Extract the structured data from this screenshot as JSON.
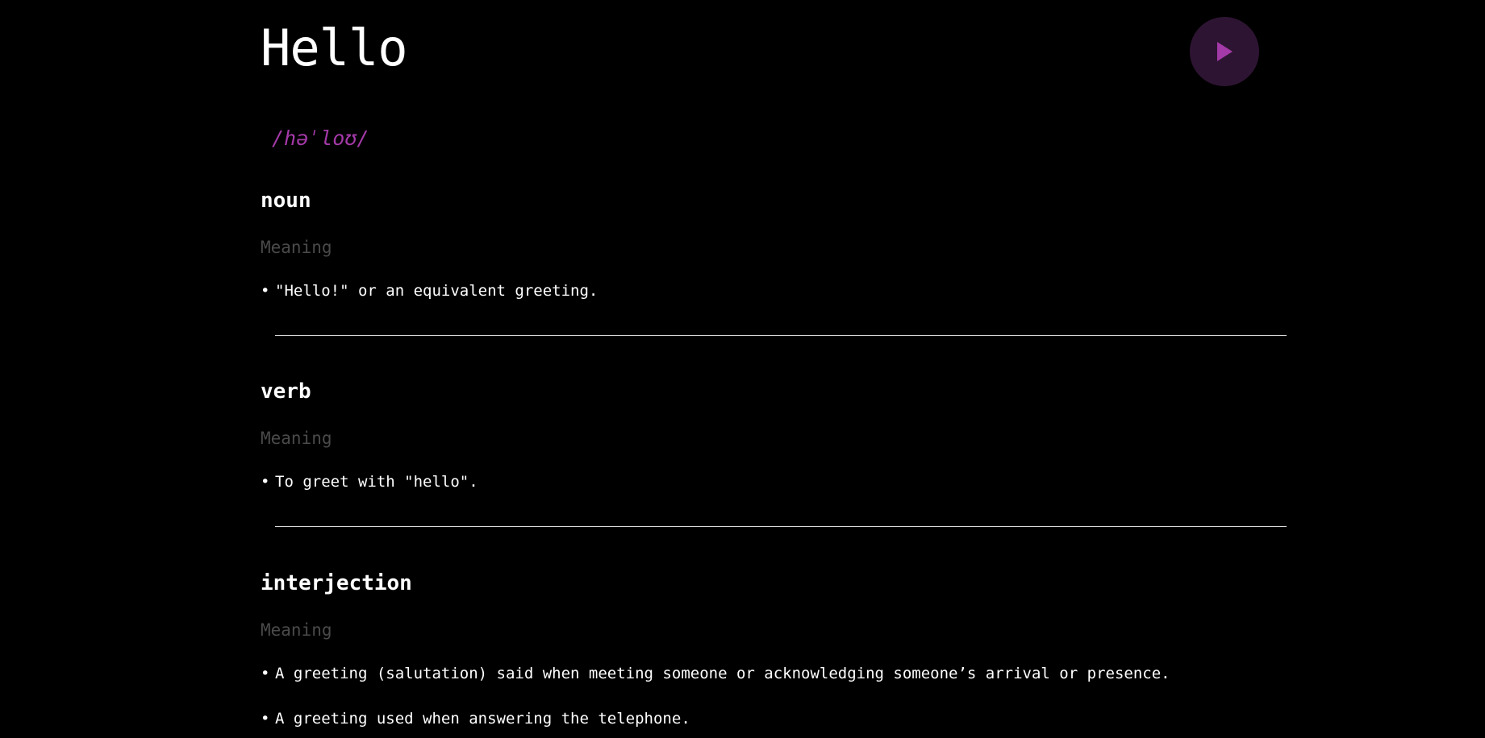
{
  "word": "Hello",
  "phonetic": "/həˈloʊ/",
  "play_icon": "play-icon",
  "colors": {
    "background": "#000000",
    "accent": "#a43aa8",
    "play_button_bg": "#2e1433",
    "muted": "#4a4a4a",
    "text": "#ffffff"
  },
  "meanings": [
    {
      "part_of_speech": "noun",
      "meaning_label": "Meaning",
      "definitions": [
        "\"Hello!\" or an equivalent greeting."
      ]
    },
    {
      "part_of_speech": "verb",
      "meaning_label": "Meaning",
      "definitions": [
        "To greet with \"hello\"."
      ]
    },
    {
      "part_of_speech": "interjection",
      "meaning_label": "Meaning",
      "definitions": [
        "A greeting (salutation) said when meeting someone or acknowledging someone’s arrival or presence.",
        "A greeting used when answering the telephone."
      ]
    }
  ]
}
